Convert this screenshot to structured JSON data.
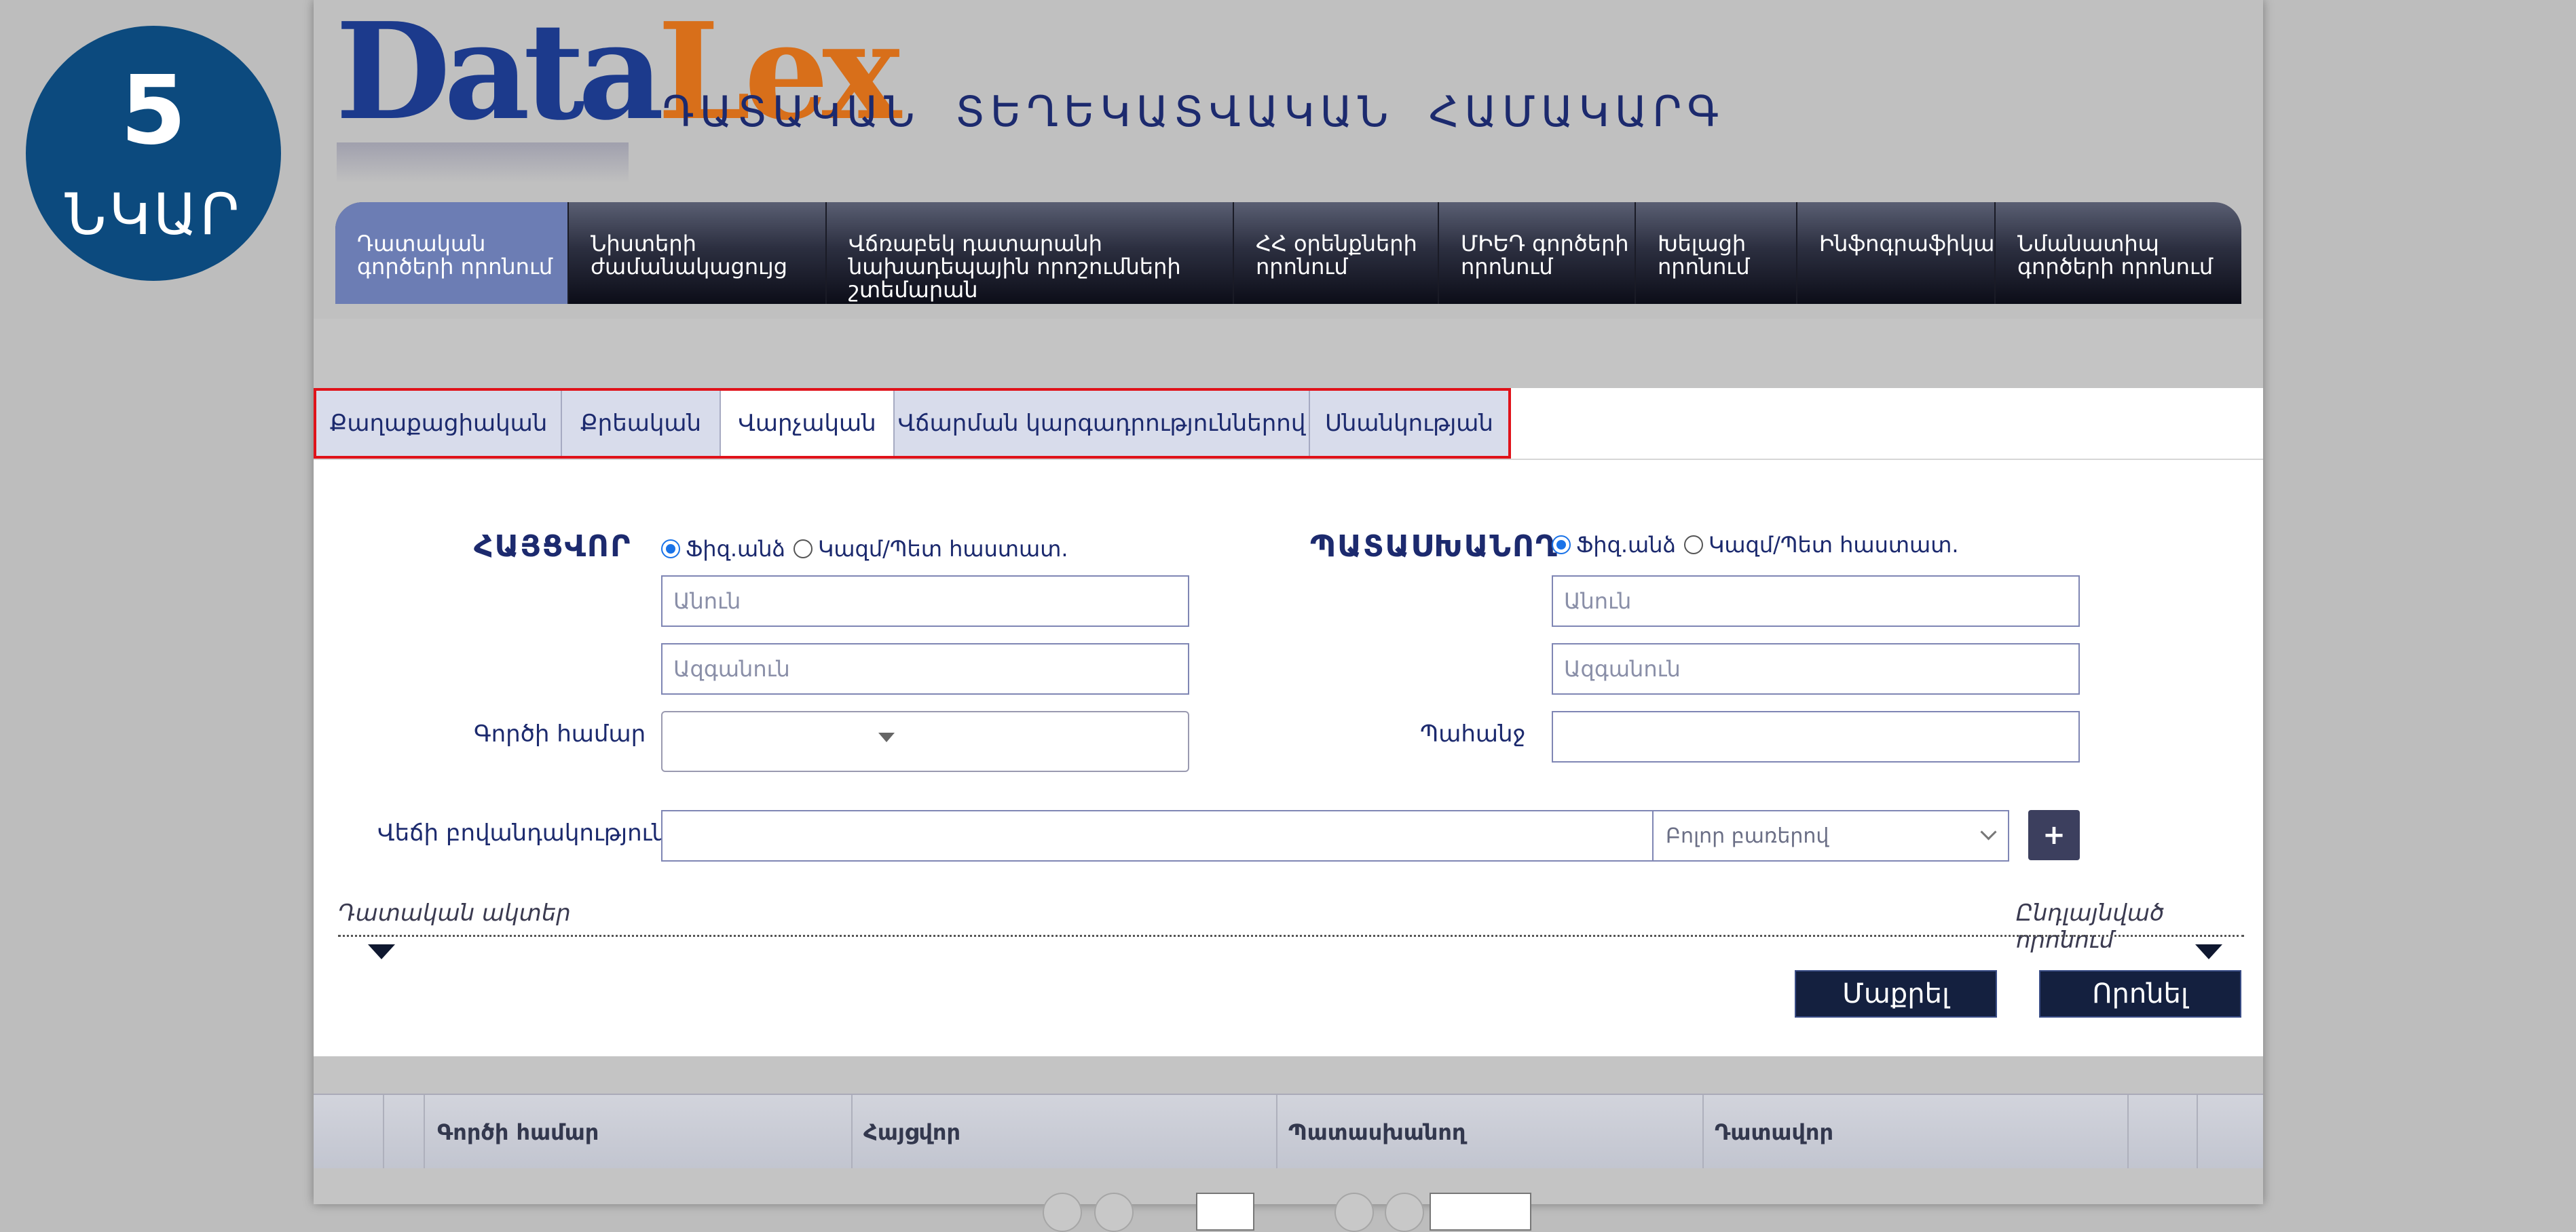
{
  "step_badge": {
    "number": "5",
    "word": "ՆԿԱՐ"
  },
  "header": {
    "logo_part1": "Data",
    "logo_part2": "Lex",
    "site_title": "ԴԱՏԱԿԱՆ ՏԵՂԵԿԱՏՎԱԿԱՆ ՀԱՄԱԿԱՐԳ"
  },
  "nav": {
    "items": [
      {
        "label": "Դատական գործերի որոնում",
        "active": true
      },
      {
        "label": "Նիստերի ժամանակացույց"
      },
      {
        "label": "Վճռաբեկ դատարանի նախադեպային որոշումների շտեմարան"
      },
      {
        "label": "ՀՀ օրենքների որոնում"
      },
      {
        "label": "ՄԻԵԴ գործերի որոնում"
      },
      {
        "label": "Խելացի որոնում"
      },
      {
        "label": "Ինֆոգրաֆիկա"
      },
      {
        "label": "Նմանատիպ գործերի որոնում"
      }
    ]
  },
  "case_tabs": {
    "items": [
      {
        "label": "Քաղաքացիական"
      },
      {
        "label": "Քրեական"
      },
      {
        "label": "Վարչական",
        "active": true
      },
      {
        "label": "Վճարման կարգադրություններով"
      },
      {
        "label": "Սնանկության"
      }
    ]
  },
  "search_form": {
    "plaintiff": {
      "label": "ՀԱՅՑՎՈՐ",
      "radio_person": "Ֆիզ.անձ",
      "radio_org": "Կազմ/Պետ հաստատ.",
      "name_placeholder": "Անուն",
      "surname_placeholder": "Ազգանուն"
    },
    "defendant": {
      "label": "ՊԱՏԱՍԽԱՆՈՂ",
      "radio_person": "Ֆիզ.անձ",
      "radio_org": "Կազմ/Պետ հաստատ.",
      "name_placeholder": "Անուն",
      "surname_placeholder": "Ազգանուն"
    },
    "case_number_label": "Գործի համար",
    "case_number_value": "",
    "claim_label": "Պահանջ",
    "claim_value": "",
    "dispute_content_label": "Վեճի բովանդակություն",
    "dispute_content_value": "",
    "match_mode_selected": "Բոլոր բառերով",
    "add_button": "+",
    "court_acts_link": "Դատական ակտեր",
    "advanced_search_link": "Ընդլայնված որոնում",
    "clear_button": "Մաքրել",
    "search_button": "Որոնել"
  },
  "results_table": {
    "columns": [
      "Գործի համար",
      "Հայցվոր",
      "Պատասխանող",
      "Դատավոր"
    ]
  },
  "colors": {
    "accent": "#0c4a7e",
    "nav_active": "#6c7db4",
    "highlight_box": "#e0121a",
    "button": "#14203f"
  }
}
